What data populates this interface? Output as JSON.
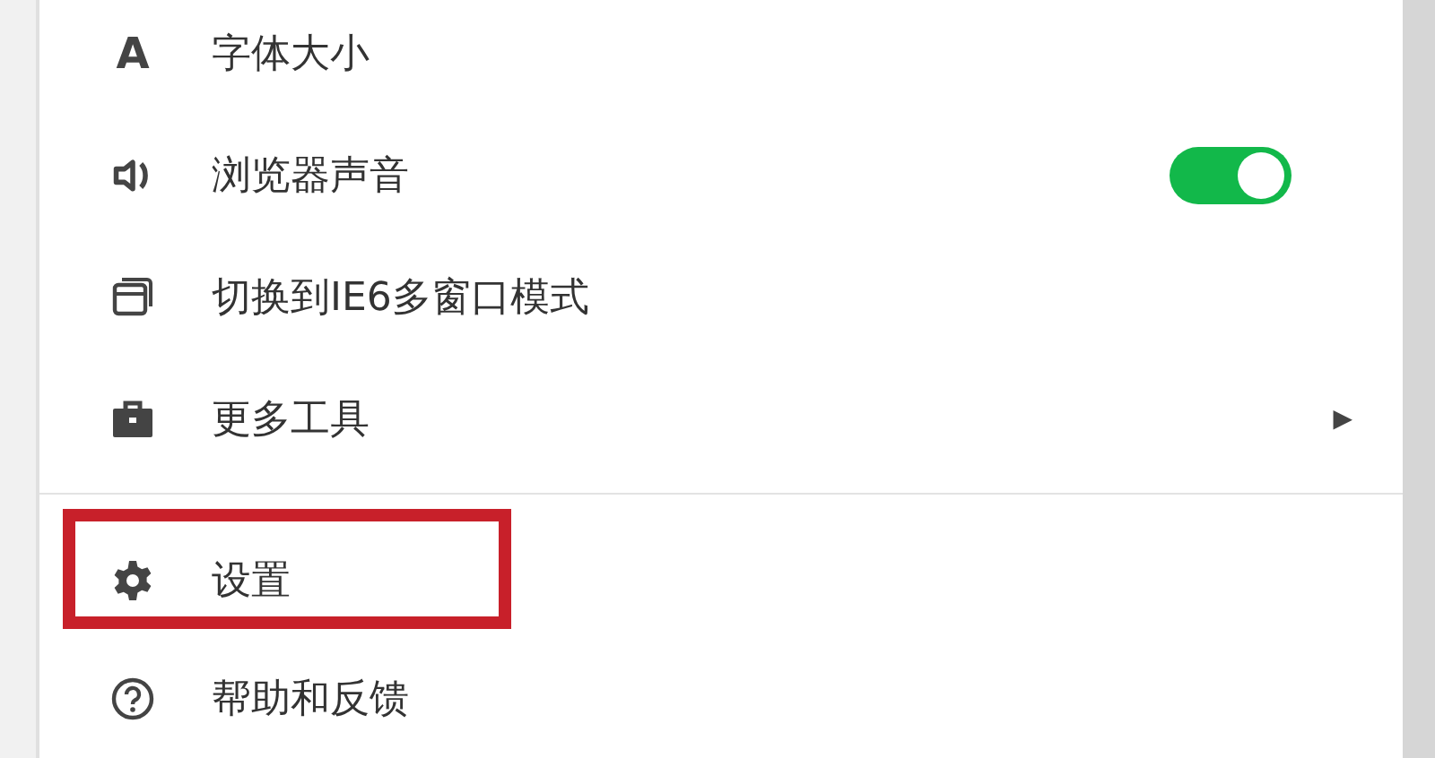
{
  "menu": {
    "items": [
      {
        "kind": "plain",
        "glyph": "A",
        "label": "字体大小"
      },
      {
        "kind": "toggle",
        "label": "浏览器声音",
        "on": true
      },
      {
        "kind": "plain",
        "label": "切换到IE6多窗口模式"
      },
      {
        "kind": "submenu",
        "label": "更多工具",
        "arrow": "▶"
      }
    ],
    "footer_items": [
      {
        "label": "设置",
        "highlighted": true
      },
      {
        "label": "帮助和反馈",
        "highlighted": false
      }
    ]
  }
}
